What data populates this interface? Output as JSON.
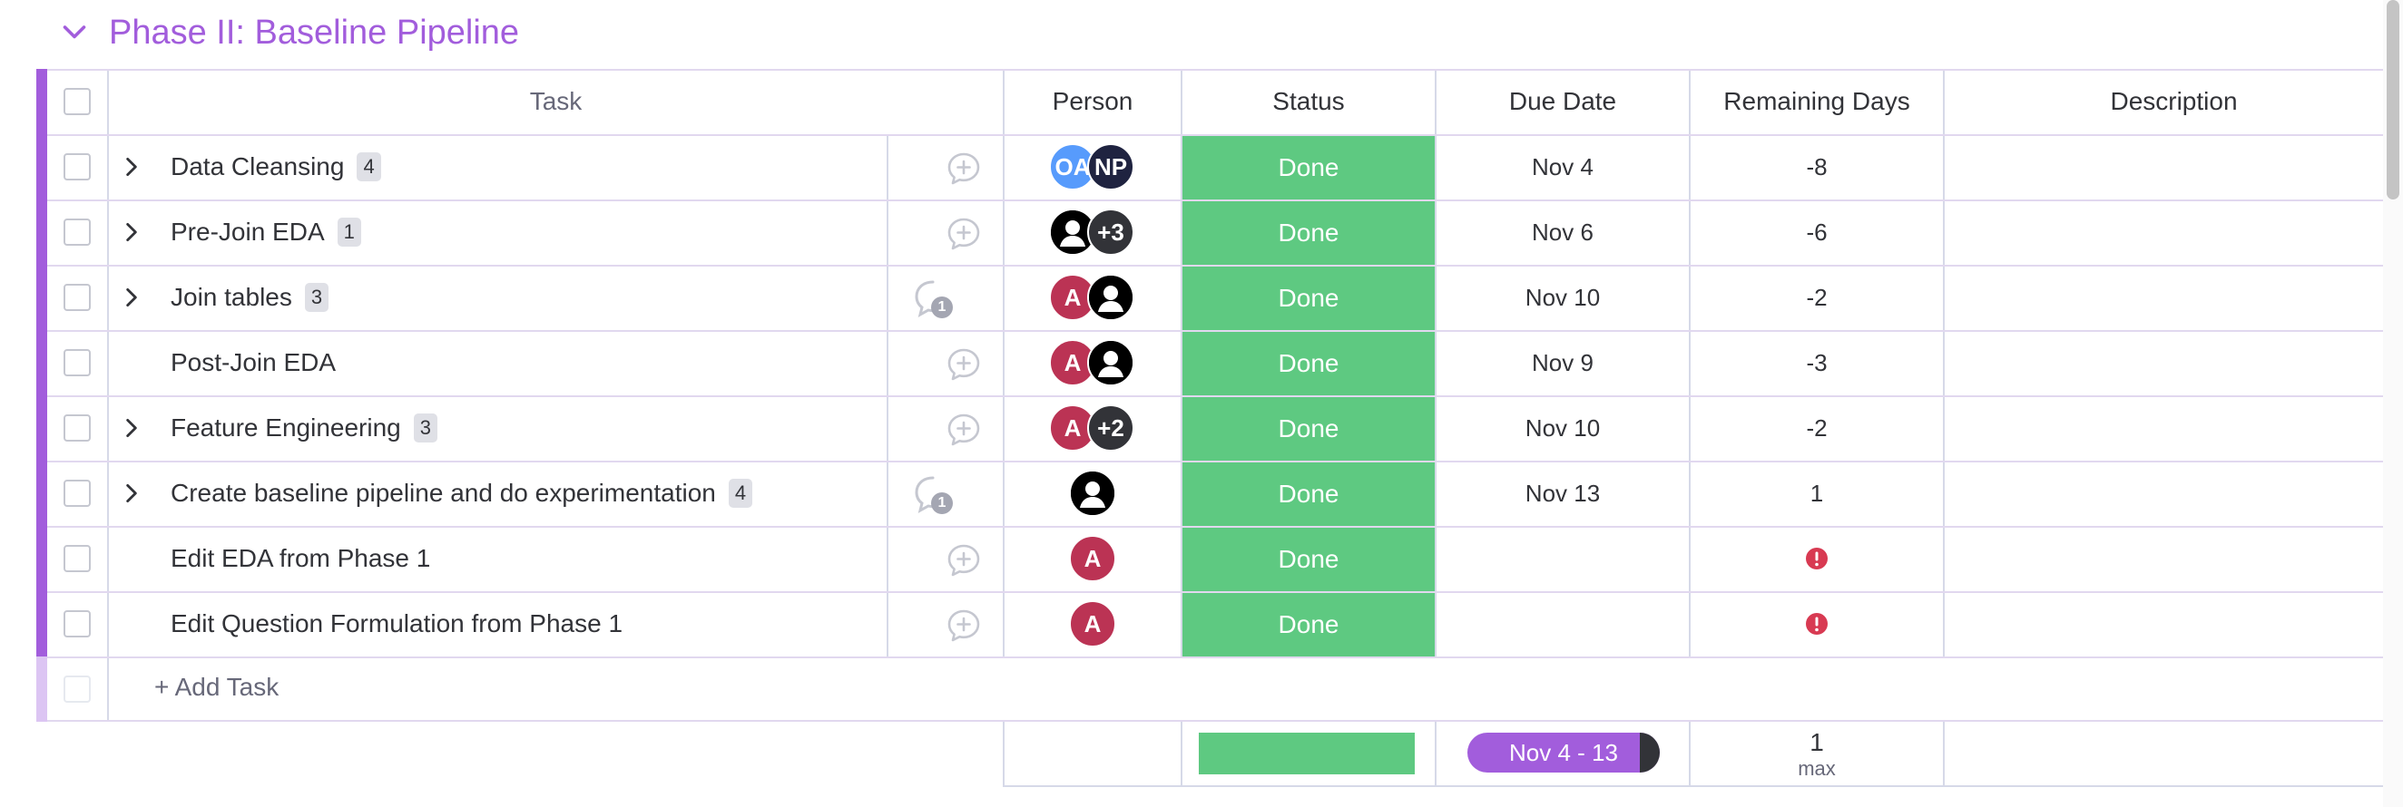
{
  "group": {
    "title": "Phase II: Baseline Pipeline",
    "color": "#a25ddc"
  },
  "columns": {
    "task": "Task",
    "person": "Person",
    "status": "Status",
    "due_date": "Due Date",
    "remaining_days": "Remaining Days",
    "description": "Description"
  },
  "rows": [
    {
      "name": "Data Cleansing",
      "subitems": "4",
      "expandable": true,
      "has_updates": false,
      "update_count": "",
      "people": [
        {
          "label": "OA",
          "color": "#579bfc"
        },
        {
          "label": "NP",
          "color": "#1f2340"
        }
      ],
      "status": "Done",
      "due": "Nov 4",
      "remaining": "-8"
    },
    {
      "name": "Pre-Join EDA",
      "subitems": "1",
      "expandable": true,
      "has_updates": false,
      "update_count": "",
      "people": [
        {
          "label": "user",
          "color": "#000000"
        },
        {
          "label": "+3",
          "color": "#323338"
        }
      ],
      "status": "Done",
      "due": "Nov 6",
      "remaining": "-6"
    },
    {
      "name": "Join tables",
      "subitems": "3",
      "expandable": true,
      "has_updates": true,
      "update_count": "1",
      "people": [
        {
          "label": "A",
          "color": "#bb3354"
        },
        {
          "label": "user",
          "color": "#000000"
        }
      ],
      "status": "Done",
      "due": "Nov 10",
      "remaining": "-2"
    },
    {
      "name": "Post-Join EDA",
      "subitems": "",
      "expandable": false,
      "has_updates": false,
      "update_count": "",
      "people": [
        {
          "label": "A",
          "color": "#bb3354"
        },
        {
          "label": "user",
          "color": "#000000"
        }
      ],
      "status": "Done",
      "due": "Nov 9",
      "remaining": "-3"
    },
    {
      "name": "Feature Engineering",
      "subitems": "3",
      "expandable": true,
      "has_updates": false,
      "update_count": "",
      "people": [
        {
          "label": "A",
          "color": "#bb3354"
        },
        {
          "label": "+2",
          "color": "#323338"
        }
      ],
      "status": "Done",
      "due": "Nov 10",
      "remaining": "-2"
    },
    {
      "name": "Create baseline pipeline and do experimentation",
      "subitems": "4",
      "expandable": true,
      "has_updates": true,
      "update_count": "1",
      "people": [
        {
          "label": "user",
          "color": "#000000"
        }
      ],
      "status": "Done",
      "due": "Nov 13",
      "remaining": "1"
    },
    {
      "name": "Edit EDA from Phase 1",
      "subitems": "",
      "expandable": false,
      "has_updates": false,
      "update_count": "",
      "people": [
        {
          "label": "A",
          "color": "#bb3354"
        }
      ],
      "status": "Done",
      "due": "",
      "remaining": "",
      "remaining_alert": true
    },
    {
      "name": "Edit Question Formulation from Phase 1",
      "subitems": "",
      "expandable": false,
      "has_updates": false,
      "update_count": "",
      "people": [
        {
          "label": "A",
          "color": "#bb3354"
        }
      ],
      "status": "Done",
      "due": "",
      "remaining": "",
      "remaining_alert": true
    }
  ],
  "add_task": "+ Add Task",
  "summary": {
    "status_done_fraction": 1.0,
    "timeline": "Nov 4 - 13",
    "remaining_value": "1",
    "remaining_label": "max"
  },
  "colors": {
    "done": "#5ec981",
    "accent": "#a25ddc",
    "alert": "#d83a52"
  }
}
